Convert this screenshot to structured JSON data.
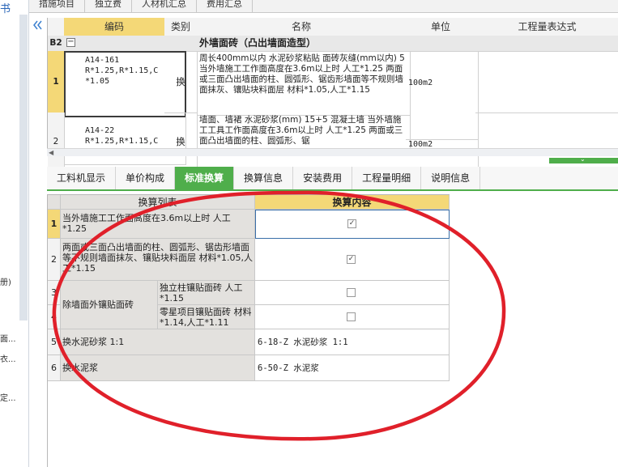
{
  "top_tabs": [
    "措施项目",
    "独立费",
    "人材机汇总",
    "费用汇总"
  ],
  "left_fragments": [
    "书",
    "册)",
    "面...",
    "衣...",
    "定..."
  ],
  "grid": {
    "headers": {
      "code": "编码",
      "category": "类别",
      "name": "名称",
      "unit": "单位",
      "quantity_expr": "工程量表达式"
    },
    "group_row": {
      "id": "B2",
      "toggle": "−",
      "name": "外墙面砖（凸出墙面造型）"
    },
    "rows": [
      {
        "num": "1",
        "code": "A14-161\nR*1.25,R*1.15,C\n*1.05",
        "category": "换",
        "name": "周长400mm以内 水泥砂浆粘贴 面砖灰缝(mm以内) 5 当外墙施工工作面高度在3.6m以上时 人工*1.25 两面或三面凸出墙面的柱、圆弧形、锯齿形墙面等不规则墙面抹灰、镶贴块料面层 材料*1.05,人工*1.15",
        "unit": "100m2"
      },
      {
        "num": "2",
        "code": "A14-22\nR*1.25,R*1.15,C",
        "category": "换",
        "name": "墙面、墙裙 水泥砂浆(mm) 15+5 混凝土墙 当外墙施工工具工作面高度在3.6m以上时 人工*1.25 两面或三面凸出墙面的柱、圆弧形、锯",
        "unit": "100m2"
      }
    ]
  },
  "lower_tabs": [
    "工料机显示",
    "单价构成",
    "标准换算",
    "换算信息",
    "安装费用",
    "工程量明细",
    "说明信息"
  ],
  "active_lower_tab": "标准换算",
  "conversion": {
    "headers": {
      "list": "换算列表",
      "content": "换算内容"
    },
    "rows": [
      {
        "num": "1",
        "list": "当外墙施工工作面高度在3.6m以上时 人工*1.25",
        "checked": true
      },
      {
        "num": "2",
        "list": "两面或三面凸出墙面的柱、圆弧形、锯齿形墙面等不规则墙面抹灰、镶贴块料面层 材料*1.05,人工*1.15",
        "checked": true
      },
      {
        "num": "3",
        "group": "除墙面外镶贴面砖",
        "list": "独立柱镶贴面砖 人工*1.15",
        "checked": false
      },
      {
        "num": "4",
        "list": "零星项目镶贴面砖 材料*1.14,人工*1.11",
        "checked": false
      },
      {
        "num": "5",
        "list": "换水泥砂浆 1:1",
        "content": "6-18-Z  水泥砂浆 1:1"
      },
      {
        "num": "6",
        "list": "换水泥浆",
        "content": "6-50-Z  水泥浆"
      }
    ]
  },
  "colors": {
    "accent_green": "#4fae4b",
    "header_yellow": "#f4d877",
    "annotation_red": "#e0202a"
  },
  "icons": {
    "collapse": "double-chevron-left-icon",
    "check": "checkmark-icon"
  }
}
